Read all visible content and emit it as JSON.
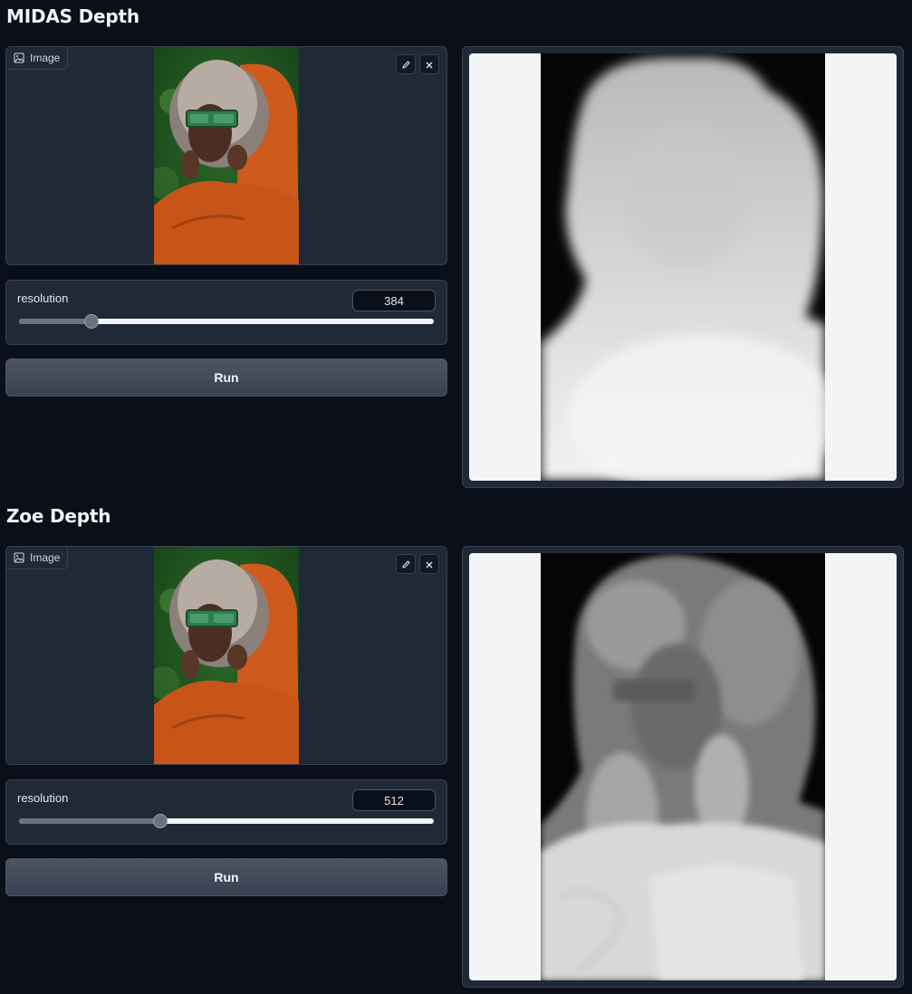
{
  "sections": [
    {
      "title": "MIDAS Depth",
      "image_label": "Image",
      "slider_label": "resolution",
      "slider_value": "384",
      "slider_fraction": 0.175,
      "run_label": "Run"
    },
    {
      "title": "Zoe Depth",
      "image_label": "Image",
      "slider_label": "resolution",
      "slider_value": "512",
      "slider_fraction": 0.34,
      "run_label": "Run"
    }
  ],
  "icons": {
    "image": "image-icon",
    "edit": "pencil-icon",
    "clear": "close-icon"
  }
}
